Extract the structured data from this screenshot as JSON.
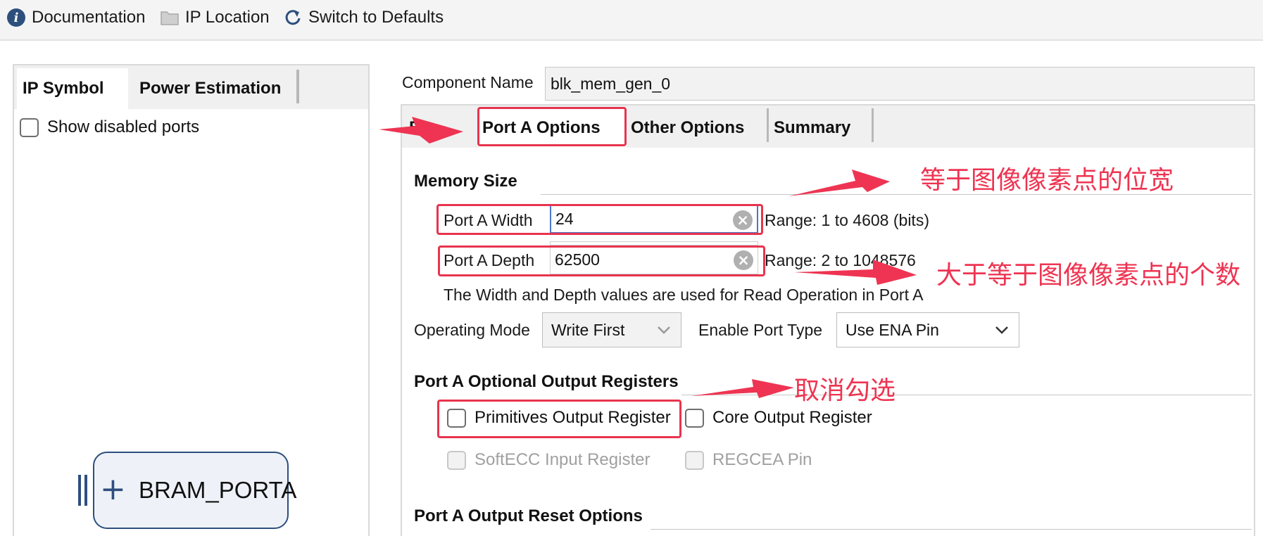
{
  "toolbar": {
    "documentation": "Documentation",
    "ip_location": "IP Location",
    "switch_defaults": "Switch to Defaults"
  },
  "left_panel": {
    "tabs": [
      "IP Symbol",
      "Power Estimation"
    ],
    "show_disabled_ports": "Show disabled ports",
    "bram_port": "BRAM_PORTA"
  },
  "component": {
    "label": "Component Name",
    "value": "blk_mem_gen_0"
  },
  "right_tabs": [
    "Ba",
    "Port A Options",
    "Other Options",
    "Summary"
  ],
  "memory_size": {
    "title": "Memory Size",
    "width_label": "Port A Width",
    "width_value": "24",
    "width_range": "Range: 1 to 4608 (bits)",
    "depth_label": "Port A Depth",
    "depth_value": "62500",
    "depth_range": "Range: 2 to 1048576",
    "note": "The Width and Depth values are used for Read Operation in Port A"
  },
  "operating": {
    "mode_label": "Operating Mode",
    "mode_value": "Write First",
    "enable_label": "Enable Port Type",
    "enable_value": "Use ENA Pin"
  },
  "output_registers": {
    "title": "Port A Optional Output Registers",
    "primitives": "Primitives Output Register",
    "core": "Core Output Register",
    "softecc": "SoftECC Input Register",
    "regcea": "REGCEA Pin"
  },
  "reset_options": {
    "title": "Port A Output Reset Options"
  },
  "annotations": {
    "width_note": "等于图像像素点的位宽",
    "depth_note": "大于等于图像像素点的个数",
    "uncheck_note": "取消勾选"
  },
  "colors": {
    "annotation_red": "#ee3452",
    "focus_blue": "#4a78c8",
    "symbol_blue": "#2e4e7e"
  }
}
